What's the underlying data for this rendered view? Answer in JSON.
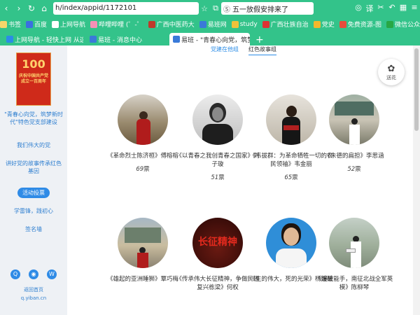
{
  "toolbar": {
    "url": "h/index/appid/1172101",
    "search": "五一放假安排来了",
    "back": "‹",
    "forward": "›",
    "reload": "↻",
    "home": "⌂",
    "star": "☆",
    "copy": "⧉",
    "menu": "≡"
  },
  "bookmarks": [
    {
      "label": "书签",
      "color": "#f5d66a"
    },
    {
      "label": "百度",
      "color": "#3b6fe0"
    },
    {
      "label": "上网导航",
      "color": "#ffffff"
    },
    {
      "label": "哔哩哔哩 (゜-゜",
      "color": "#f590b6"
    },
    {
      "label": "广西中医药大",
      "color": "#c0392b"
    },
    {
      "label": "易班网",
      "color": "#3a7ad9"
    },
    {
      "label": "study",
      "color": "#f0c23a"
    },
    {
      "label": "广西壮族自治",
      "color": "#d33"
    },
    {
      "label": "党史",
      "color": "#f2b82c"
    },
    {
      "label": "免费资源-图",
      "color": "#e74c3c"
    },
    {
      "label": "微信公众平台",
      "color": "#28a745"
    }
  ],
  "tabs": [
    {
      "label": "上网导航 - 轻快上网 从这里开"
    },
    {
      "label": "易班 - 消息中心"
    },
    {
      "label": "易班 - \"青春心向党，筑梦新\""
    }
  ],
  "main": {
    "subtabs": [
      "党建在他组",
      "红色故事组"
    ],
    "feedback": "送花",
    "cards": [
      {
        "caption": "《革命烈士陈济桓》傅榕榕",
        "votes": "69",
        "unit": "票"
      },
      {
        "caption": "《以青春之我创青春之国家》刘子璇",
        "votes": "51",
        "unit": "票"
      },
      {
        "caption": "《韦拔群：为革命牺牲一切的农民领袖》韦金丽",
        "votes": "65",
        "unit": "票"
      },
      {
        "caption": "《朱德的扁担》李思涵",
        "votes": "52",
        "unit": "票"
      },
      {
        "caption": "《雄起的亚洲睡狮》覃巧梅",
        "votes": "",
        "unit": ""
      },
      {
        "caption": "《传承伟大长征精神，争做民族复兴栋梁》何权",
        "votes": "",
        "unit": ""
      },
      {
        "caption": "《生的伟大，死的光荣》杨媛媛",
        "votes": "",
        "unit": ""
      },
      {
        "caption": "《爆破能手，南征北战全军英模》陈柳琴",
        "votes": "",
        "unit": ""
      }
    ],
    "poster_text": "长征精神"
  },
  "sidebar": {
    "logo_text": "100",
    "logo_sub": "庆祝中国共产党成立一百周年",
    "title": "\"青春心向党，筑梦新时代\"特色党支部建设",
    "links": [
      "我们伟大的党",
      "讲好党的故事传承红色基因"
    ],
    "button": "活动投票",
    "links2": [
      "学雷锋，践初心",
      "签名墙"
    ],
    "footer1": "返回首页",
    "footer2": "q.yiban.cn"
  }
}
